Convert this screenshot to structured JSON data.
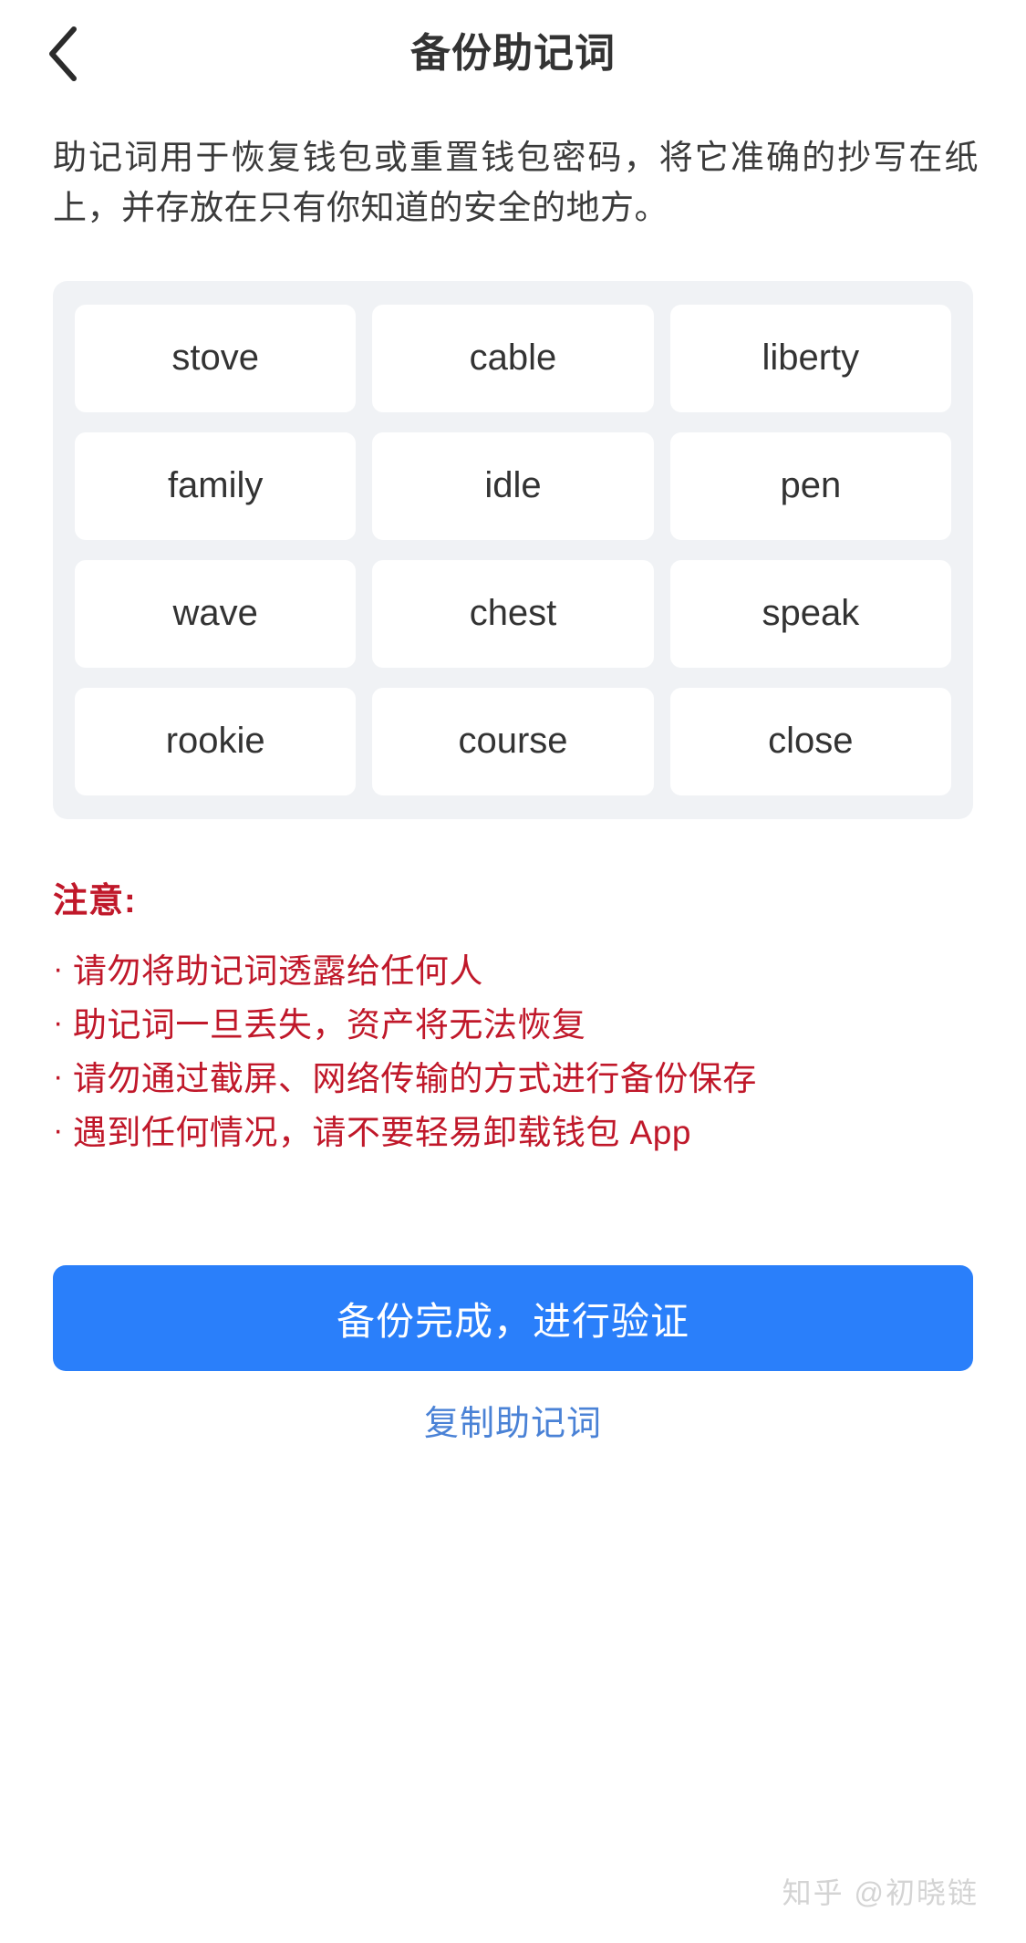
{
  "header": {
    "back_icon": "chevron-left-icon",
    "title": "备份助记词"
  },
  "description": "助记词用于恢复钱包或重置钱包密码，将它准确的抄写在纸上，并存放在只有你知道的安全的地方。",
  "mnemonic": {
    "words": [
      "stove",
      "cable",
      "liberty",
      "family",
      "idle",
      "pen",
      "wave",
      "chest",
      "speak",
      "rookie",
      "course",
      "close"
    ]
  },
  "warning": {
    "title": "注意:",
    "bullet": "·",
    "items": [
      "请勿将助记词透露给任何人",
      "助记词一旦丢失，资产将无法恢复",
      "请勿通过截屏、网络传输的方式进行备份保存",
      "遇到任何情况，请不要轻易卸载钱包 App"
    ]
  },
  "actions": {
    "primary_label": "备份完成，进行验证",
    "link_label": "复制助记词"
  },
  "watermark": "知乎 @初晓链",
  "colors": {
    "primary": "#2a7ffa",
    "link": "#4a82d6",
    "warning": "#c0182a",
    "grid_bg": "#f0f2f5",
    "cell_bg": "#ffffff",
    "text": "#333333"
  }
}
